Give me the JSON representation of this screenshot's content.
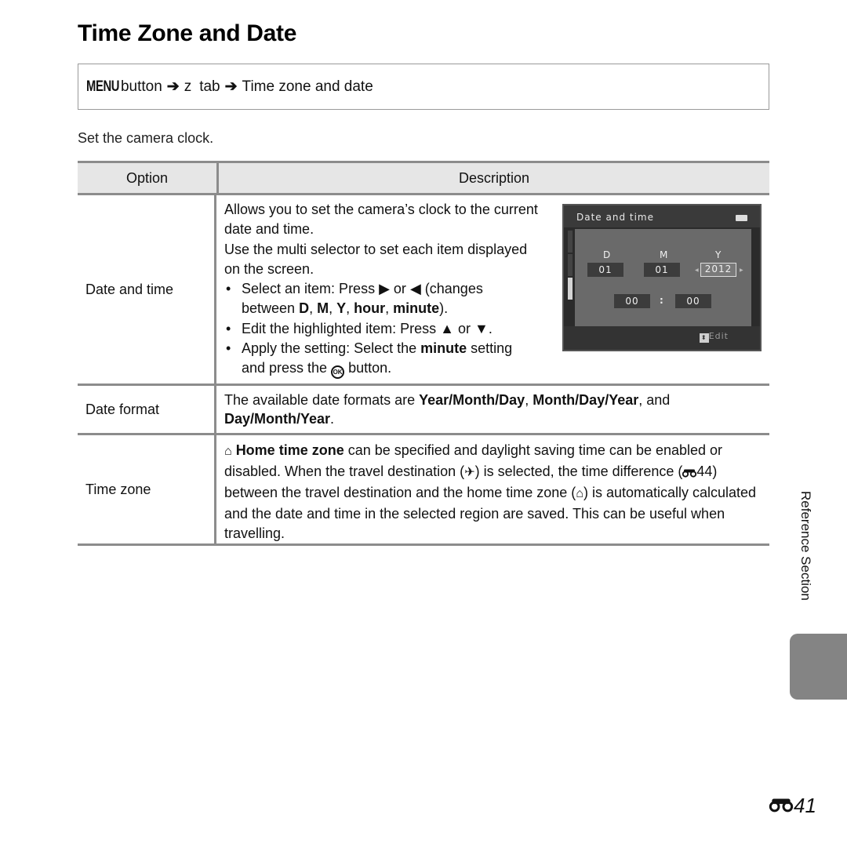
{
  "page": {
    "title": "Time Zone and Date",
    "intro": "Set the camera clock.",
    "section_label": "Reference Section",
    "page_number": "41",
    "page_prefix_icon": "reference-binoculars-icon"
  },
  "nav": {
    "menu": "MENU",
    "button": "button",
    "arrow": "➔",
    "tab_glyph": "z",
    "tab": "tab",
    "destination": "Time zone and date"
  },
  "table": {
    "headers": {
      "option": "Option",
      "description": "Description"
    },
    "rows": [
      {
        "option": "Date and time",
        "p1": "Allows you to set the camera’s clock to the current date and time.",
        "p2": "Use the multi selector to set each item displayed on the screen.",
        "b1_pre": "Select an item: Press ",
        "b1_right": "▶",
        "b1_or": " or ",
        "b1_left": "◀",
        "b1_mid": " (changes between ",
        "b1_d": "D",
        "b1_m": "M",
        "b1_y": "Y",
        "b1_hour": "hour",
        "b1_minute": "minute",
        "b1_end": ").",
        "b2_pre": "Edit the highlighted item: Press ",
        "b2_up": "▲",
        "b2_or": " or ",
        "b2_down": "▼",
        "b2_end": ".",
        "b3_pre": "Apply the setting: Select the ",
        "b3_bold": "minute",
        "b3_mid": " setting and press the ",
        "b3_ok": "OK",
        "b3_end": " button."
      },
      {
        "option": "Date format",
        "pre": "The available date formats are ",
        "f1": "Year/Month/Day",
        "sep1": ", ",
        "f2": "Month/Day/Year",
        "sep2": ", and ",
        "f3": "Day/Month/Year",
        "end": "."
      },
      {
        "option": "Time zone",
        "home_bold": "Home time zone",
        "t1": " can be specified and daylight saving time can be enabled or disabled. When the travel destination (",
        "t2": ") is selected, the time difference (",
        "ref": "44",
        "t3": ") between the travel destination and the home time zone (",
        "t4": ") is automatically calculated and the date and time in the selected region are saved. This can be useful when travelling."
      }
    ]
  },
  "camera_screen": {
    "title": "Date and time",
    "labels": {
      "d": "D",
      "m": "M",
      "y": "Y"
    },
    "day": "01",
    "month": "01",
    "year": "2012",
    "hour": "00",
    "colon": ":",
    "minute": "00",
    "edit_label": "Edit",
    "selected_field": "year"
  }
}
